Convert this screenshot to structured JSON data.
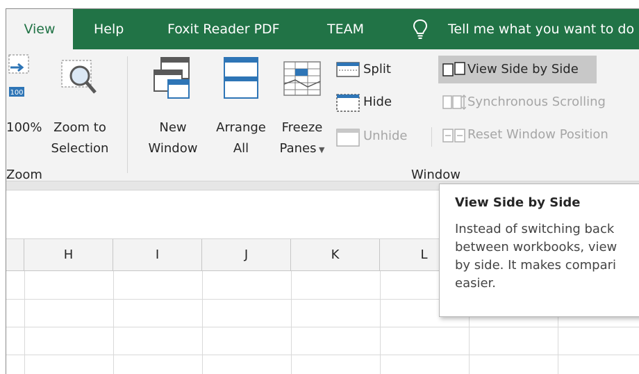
{
  "tabs": {
    "view": "View",
    "help": "Help",
    "foxit": "Foxit Reader PDF",
    "team": "TEAM",
    "tell_me": "Tell me what you want to do"
  },
  "ribbon": {
    "zoom_group": {
      "zoom_100_label": "100%",
      "zoom_to_selection_line1": "Zoom to",
      "zoom_to_selection_line2": "Selection",
      "group_label": "Zoom"
    },
    "window_group": {
      "new_window_line1": "New",
      "new_window_line2": "Window",
      "arrange_all_line1": "Arrange",
      "arrange_all_line2": "All",
      "freeze_panes_line1": "Freeze",
      "freeze_panes_line2": "Panes",
      "split": "Split",
      "hide": "Hide",
      "unhide": "Unhide",
      "view_side_by_side": "View Side by Side",
      "synchronous_scrolling": "Synchronous Scrolling",
      "reset_window_position": "Reset Window Position",
      "group_label": "Window"
    }
  },
  "grid": {
    "columns": [
      "H",
      "I",
      "J",
      "K",
      "L"
    ]
  },
  "tooltip": {
    "title": "View Side by Side",
    "line1": "Instead of switching back",
    "line2": "between workbooks, view",
    "line3": "by side. It makes compari",
    "line4": "easier."
  },
  "colors": {
    "excel_green": "#217346",
    "ribbon_bg": "#f3f3f3",
    "highlight": "#c8c8c8",
    "icon_blue": "#2e75b6"
  }
}
